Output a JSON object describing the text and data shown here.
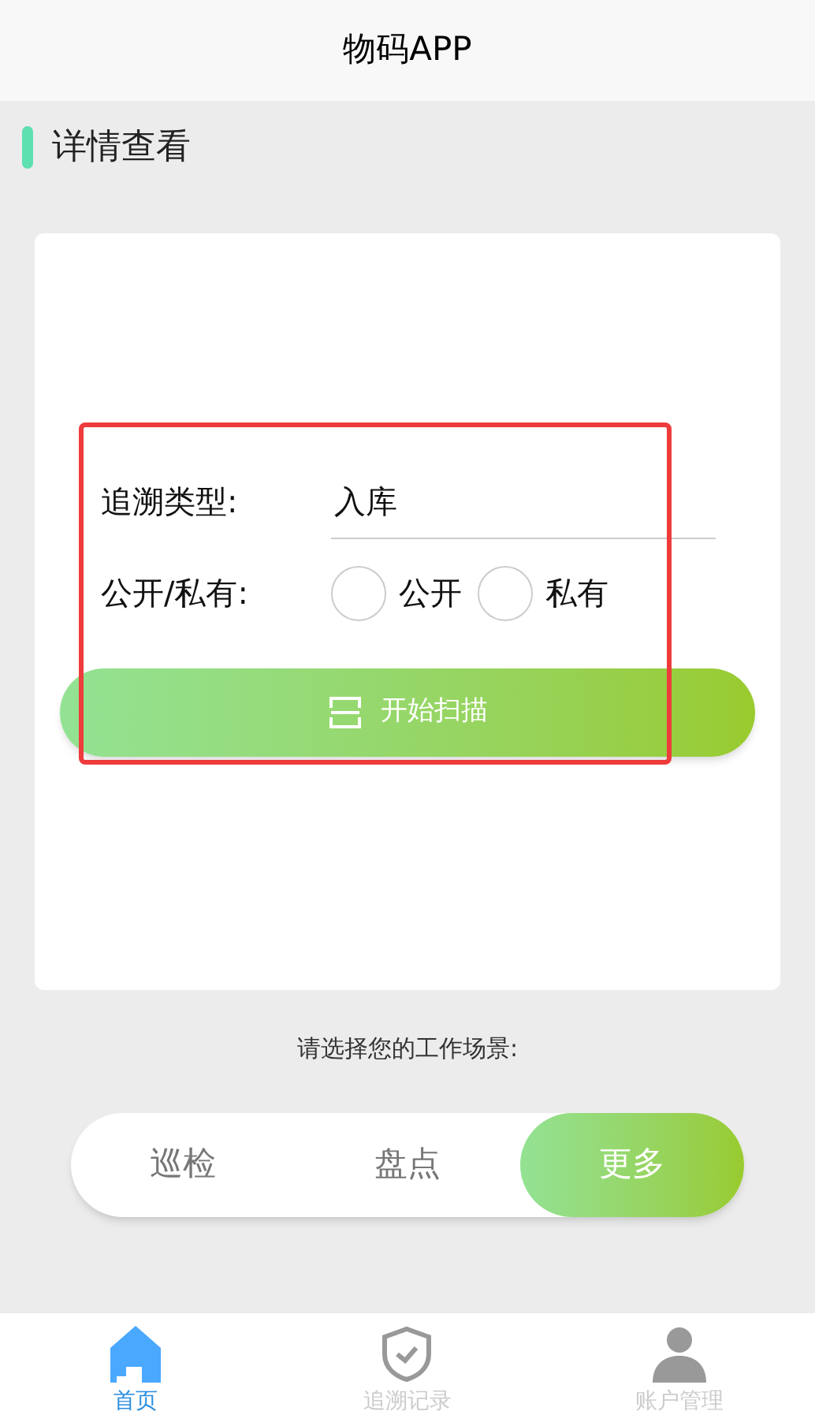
{
  "header": {
    "title": "物码APP"
  },
  "section": {
    "title": "详情查看"
  },
  "form": {
    "type_label": "追溯类型:",
    "type_value": "入库",
    "visibility_label": "公开/私有:",
    "options": [
      {
        "label": "公开",
        "selected": false
      },
      {
        "label": "私有",
        "selected": false
      }
    ],
    "scan_button": "开始扫描"
  },
  "prompt": "请选择您的工作场景:",
  "scenes": [
    {
      "label": "巡检",
      "selected": false
    },
    {
      "label": "盘点",
      "selected": false
    },
    {
      "label": "更多",
      "selected": true
    }
  ],
  "tab_bar": [
    {
      "kind": "home",
      "label": "首页",
      "selected": true
    },
    {
      "kind": "shield",
      "label": "追溯记录",
      "selected": false
    },
    {
      "kind": "user",
      "label": "账户管理",
      "selected": false
    }
  ]
}
